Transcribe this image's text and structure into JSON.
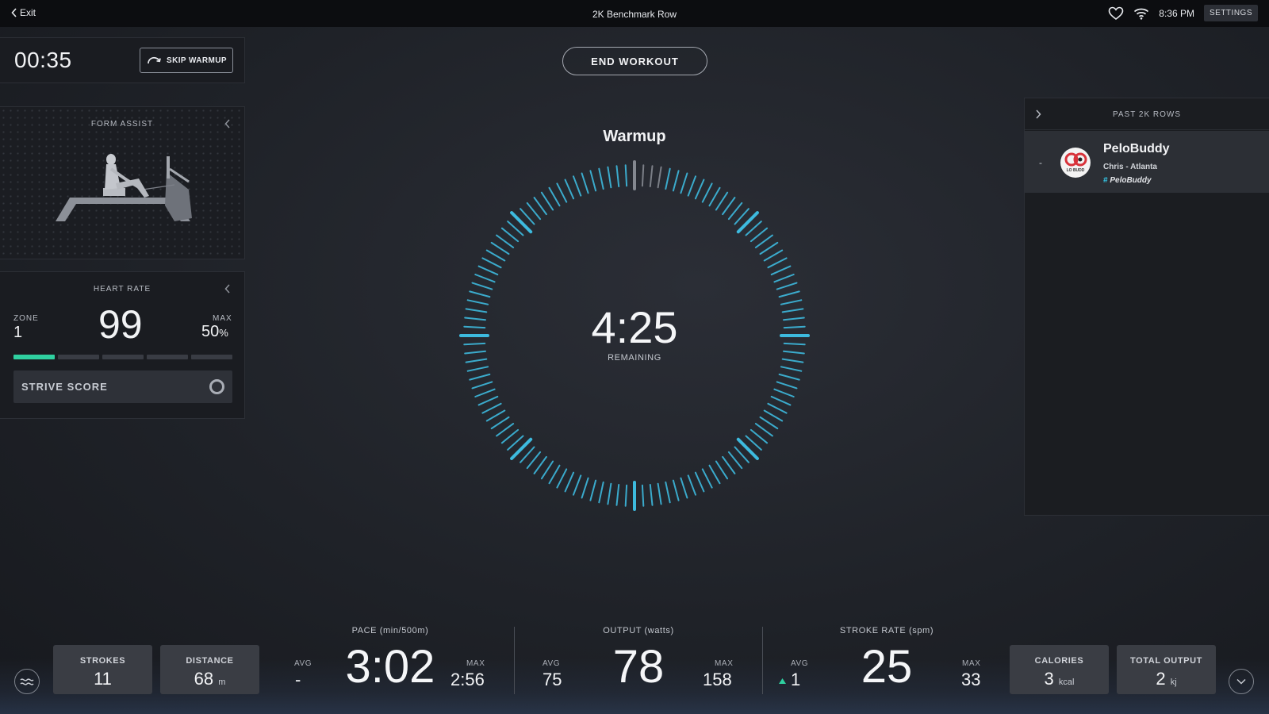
{
  "topbar": {
    "exit_label": "Exit",
    "title": "2K Benchmark Row",
    "time": "8:36 PM",
    "settings_label": "SETTINGS"
  },
  "timer": {
    "value": "00:35",
    "skip_label": "SKIP WARMUP"
  },
  "form_assist": {
    "heading": "FORM ASSIST"
  },
  "heart_rate": {
    "heading": "HEART RATE",
    "zone_label": "ZONE",
    "zone_value": "1",
    "bpm": "99",
    "max_label": "MAX",
    "max_value": "50",
    "max_unit": "%",
    "active_zone_fraction": 0.2,
    "zone_color": "#2fd0a0",
    "strive_label": "STRIVE SCORE"
  },
  "end_workout_label": "END WORKOUT",
  "segment": {
    "title": "Warmup",
    "remaining_time": "4:25",
    "remaining_label": "REMAINING",
    "progress_fraction": 0.03,
    "accent_color": "#3fc2e8"
  },
  "leaderboard": {
    "heading": "PAST 2K ROWS",
    "entries": [
      {
        "rank": "-",
        "name": "PeloBuddy",
        "location": "Chris - Atlanta",
        "tag_symbol": "#",
        "tag": "PeloBuddy",
        "avatar_text": "LO BUDD"
      }
    ]
  },
  "stats": {
    "strokes": {
      "label": "STROKES",
      "value": "11"
    },
    "distance": {
      "label": "DISTANCE",
      "value": "68",
      "unit": "m"
    },
    "calories": {
      "label": "CALORIES",
      "value": "3",
      "unit": "kcal"
    },
    "total_output": {
      "label": "TOTAL OUTPUT",
      "value": "2",
      "unit": "kj"
    }
  },
  "metrics": {
    "pace": {
      "title": "PACE (min/500m)",
      "avg_label": "AVG",
      "avg": "-",
      "current": "3:02",
      "max_label": "MAX",
      "max": "2:56"
    },
    "output": {
      "title": "OUTPUT (watts)",
      "avg_label": "AVG",
      "avg": "75",
      "current": "78",
      "max_label": "MAX",
      "max": "158"
    },
    "stroke_rate": {
      "title": "STROKE RATE (spm)",
      "avg_label": "AVG",
      "avg": "1",
      "current": "25",
      "max_label": "MAX",
      "max": "33"
    }
  }
}
